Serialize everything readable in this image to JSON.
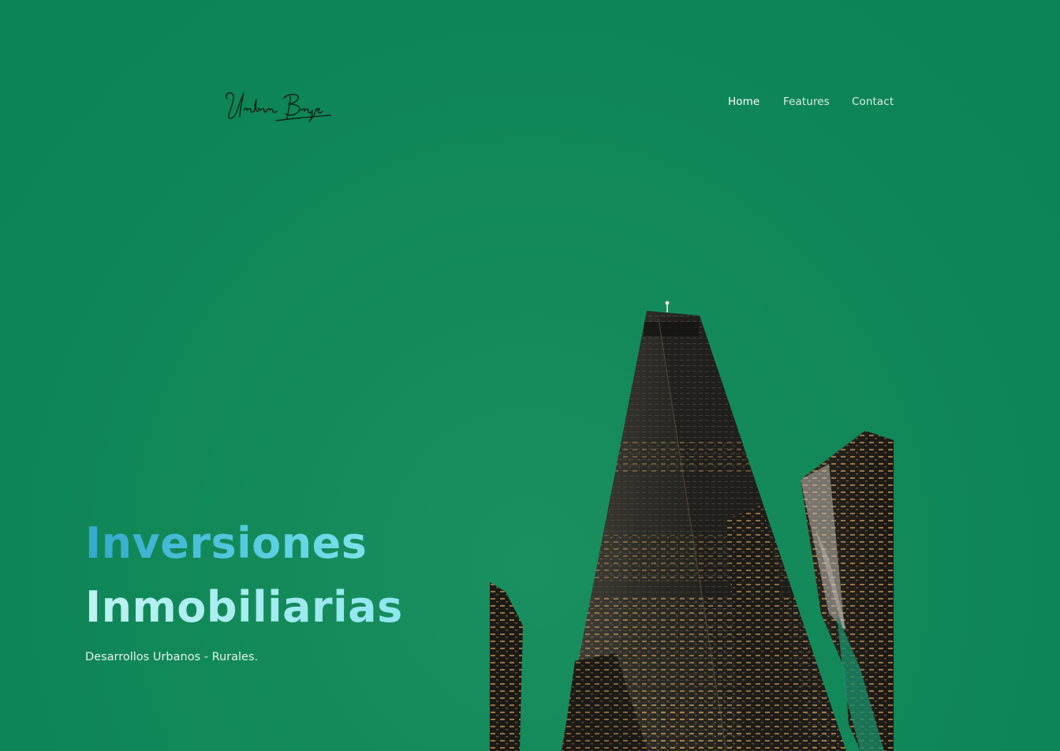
{
  "brand": {
    "logo_text": "Urban Bryc"
  },
  "nav": {
    "items": [
      {
        "label": "Home",
        "active": true
      },
      {
        "label": "Features",
        "active": false
      },
      {
        "label": "Contact",
        "active": false
      }
    ]
  },
  "hero": {
    "title_line1": "Inversiones",
    "title_line2": "Inmobiliarias",
    "subtitle": "Desarrollos Urbanos - Rurales."
  },
  "colors": {
    "background": "#0e8557",
    "title_gradient_start": "#33a8cc",
    "title_gradient_end": "#bdf2f2",
    "nav_text": "#d7efe2",
    "nav_active": "#ffffff"
  }
}
